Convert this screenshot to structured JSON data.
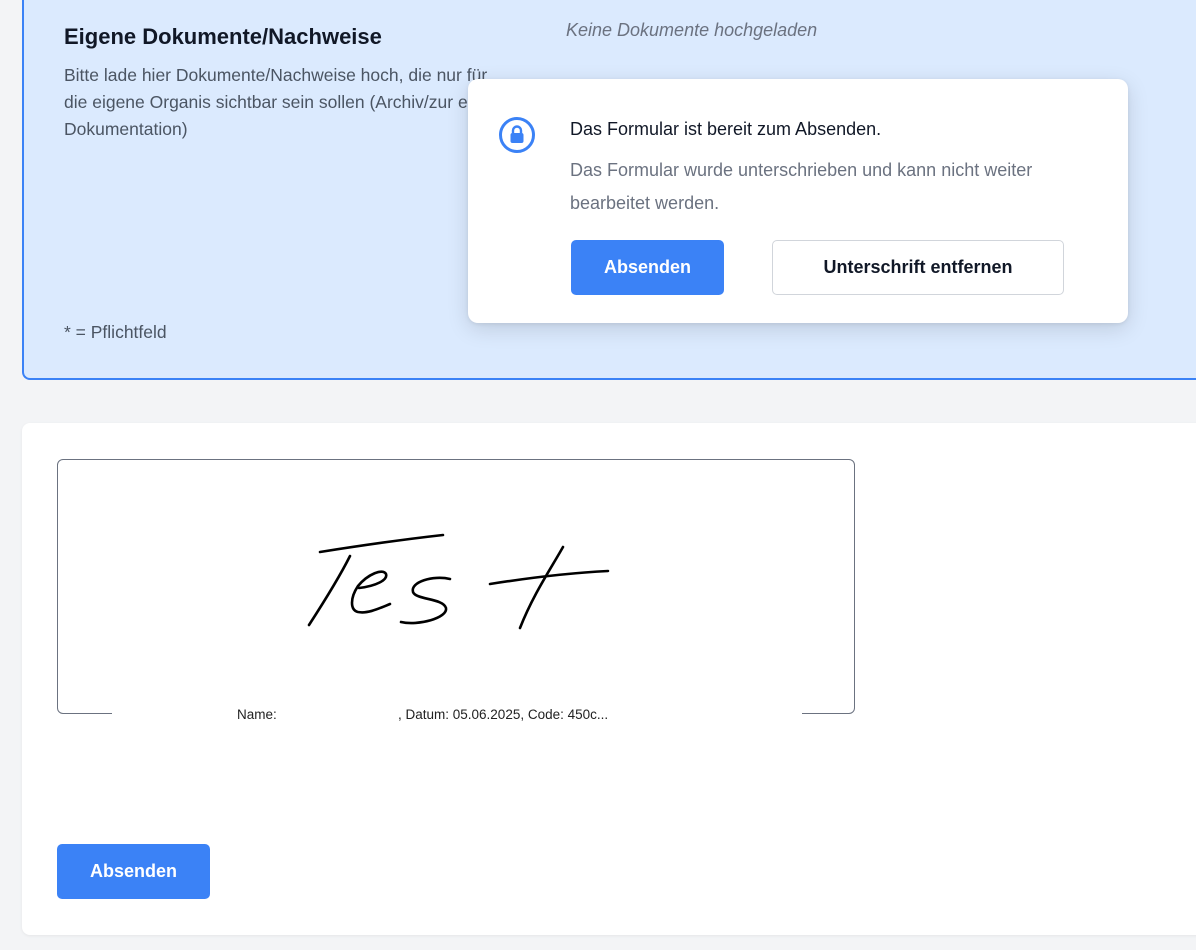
{
  "own_documents": {
    "title": "Eigene Dokumente/Nachweise",
    "description": "Bitte lade hier Dokumente/Nachweise hoch, die nur für die eigene Organis sichtbar sein sollen (Archiv/zur eige Dokumentation)",
    "no_documents_text": "Keine Dokumente hochgeladen",
    "required_note": "* = Pflichtfeld"
  },
  "popup": {
    "icon": "lock-icon",
    "title": "Das Formular ist bereit zum Absenden.",
    "message": "Das Formular wurde unterschrieben und kann nicht weiter bearbeitet werden.",
    "submit_label": "Absenden",
    "remove_signature_label": "Unterschrift entfernen"
  },
  "signature": {
    "handwritten_text": "Test",
    "caption_name": "Name:",
    "caption_details": ", Datum: 05.06.2025, Code: 450c..."
  },
  "form": {
    "submit_label": "Absenden"
  },
  "colors": {
    "accent": "#3b82f6",
    "section_background": "#dbeafe",
    "page_background": "#f3f4f6"
  }
}
